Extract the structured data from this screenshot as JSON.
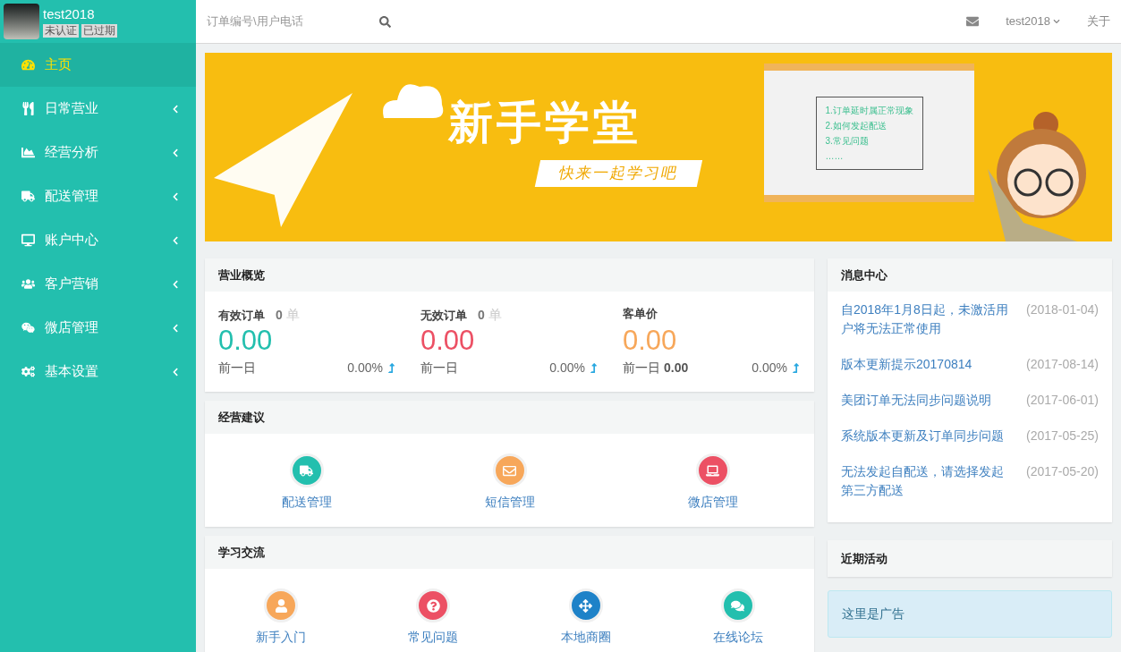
{
  "user": {
    "name": "test2018",
    "badges": [
      "未认证",
      "已过期"
    ]
  },
  "sidebar": {
    "items": [
      {
        "label": "主页",
        "selected": true,
        "has_submenu": false
      },
      {
        "label": "日常营业",
        "selected": false,
        "has_submenu": true
      },
      {
        "label": "经营分析",
        "selected": false,
        "has_submenu": true
      },
      {
        "label": "配送管理",
        "selected": false,
        "has_submenu": true
      },
      {
        "label": "账户中心",
        "selected": false,
        "has_submenu": true
      },
      {
        "label": "客户营销",
        "selected": false,
        "has_submenu": true
      },
      {
        "label": "微店管理",
        "selected": false,
        "has_submenu": true
      },
      {
        "label": "基本设置",
        "selected": false,
        "has_submenu": true
      }
    ]
  },
  "topbar": {
    "search": {
      "placeholder": "订单编号\\用户电话"
    },
    "user_menu": "test2018",
    "about": "关于"
  },
  "banner": {
    "title": "新手学堂",
    "slogan": "快来一起学习吧",
    "board_lines": [
      "1.订单延时属正常现象",
      "2.如何发起配送",
      "3.常见问题",
      "……"
    ]
  },
  "overview": {
    "title": "营业概览",
    "stats": [
      {
        "label": "有效订单",
        "count": "0",
        "unit": "单",
        "value": "0.00",
        "color": "#23bfae",
        "prev_label": "前一日",
        "change": "0.00%"
      },
      {
        "label": "无效订单",
        "count": "0",
        "unit": "单",
        "value": "0.00",
        "color": "#ec5064",
        "prev_label": "前一日",
        "change": "0.00%"
      },
      {
        "label": "客单价",
        "value": "0.00",
        "color": "#f7a75a",
        "prev_label": "前一日",
        "prev_value": "0.00",
        "change": "0.00%"
      }
    ]
  },
  "suggestions": {
    "title": "经营建议",
    "items": [
      {
        "label": "配送管理",
        "color": "#23bfae"
      },
      {
        "label": "短信管理",
        "color": "#f7a75a"
      },
      {
        "label": "微店管理",
        "color": "#ec5064"
      }
    ]
  },
  "learning": {
    "title": "学习交流",
    "items": [
      {
        "label": "新手入门",
        "color": "#f7a75a"
      },
      {
        "label": "常见问题",
        "color": "#ec5064"
      },
      {
        "label": "本地商圈",
        "color": "#1e82c8"
      },
      {
        "label": "在线论坛",
        "color": "#23bfae"
      }
    ]
  },
  "messages": {
    "title": "消息中心",
    "items": [
      {
        "text": "自2018年1月8日起，未激活用户将无法正常使用",
        "date": "(2018-01-04)"
      },
      {
        "text": "版本更新提示20170814",
        "date": "(2017-08-14)"
      },
      {
        "text": "美团订单无法同步问题说明",
        "date": "(2017-06-01)"
      },
      {
        "text": "系统版本更新及订单同步问题",
        "date": "(2017-05-25)"
      },
      {
        "text": "无法发起自配送，请选择发起第三方配送",
        "date": "(2017-05-20)"
      }
    ]
  },
  "activities": {
    "title": "近期活动",
    "ad": "这里是广告"
  }
}
